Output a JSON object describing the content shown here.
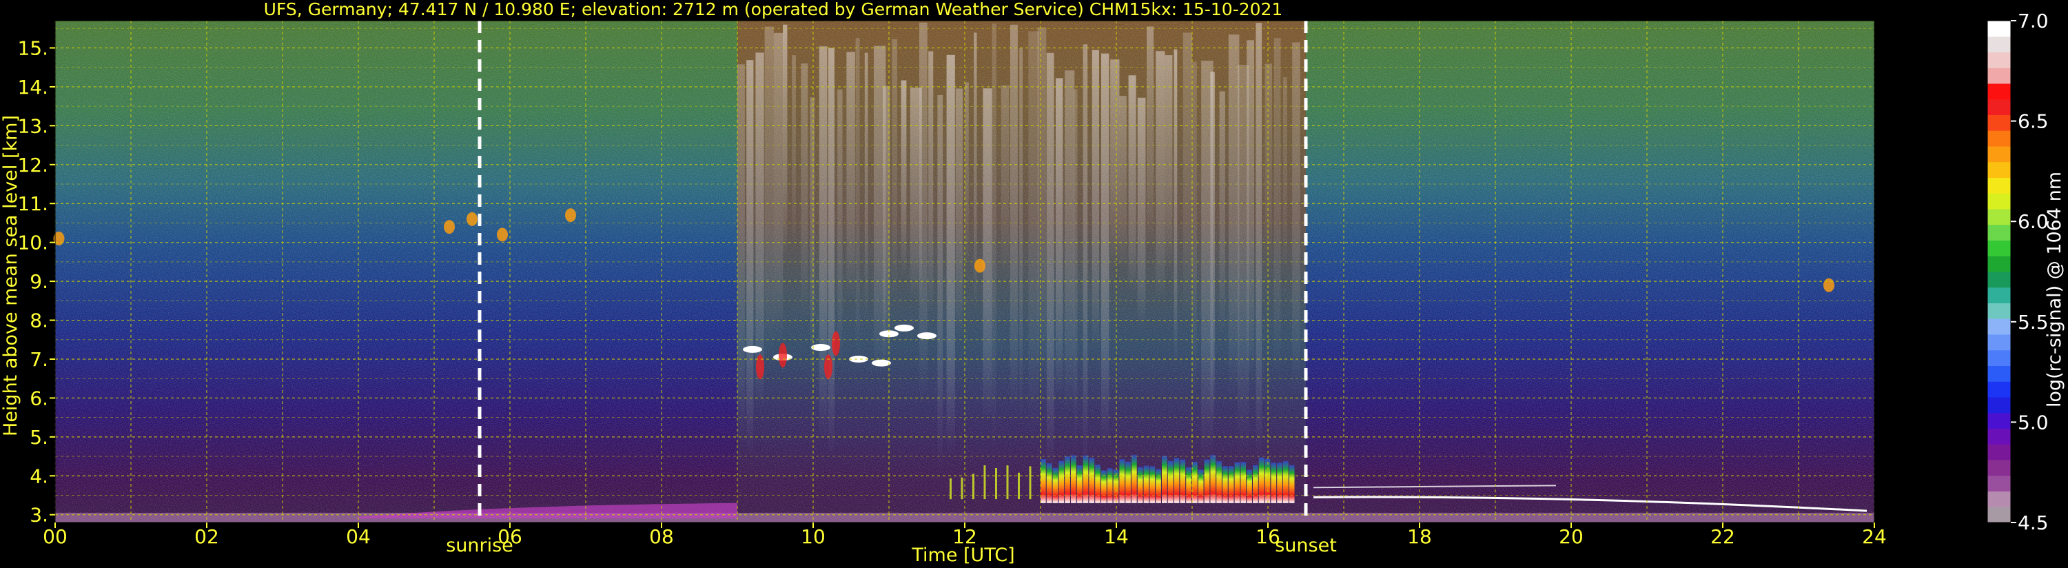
{
  "chart_data": {
    "type": "heatmap",
    "title": "UFS, Germany; 47.417 N / 10.980 E; elevation: 2712 m  (operated by German Weather Service)     CHM15kx: 15-10-2021",
    "xlabel": "Time [UTC]",
    "ylabel": "Height above mean sea level [km]",
    "xlim": [
      0,
      24
    ],
    "ylim": [
      2.8,
      15.7
    ],
    "x_ticks": [
      "00",
      "02",
      "04",
      "06",
      "08",
      "10",
      "12",
      "14",
      "16",
      "18",
      "20",
      "22",
      "24"
    ],
    "y_ticks": [
      "3.",
      "4.",
      "5.",
      "6.",
      "7.",
      "8.",
      "9.",
      "10.",
      "11.",
      "12.",
      "13.",
      "14.",
      "15."
    ],
    "grid": "on",
    "events": [
      {
        "label": "sunrise",
        "time": 5.6
      },
      {
        "label": "sunset",
        "time": 16.5
      }
    ],
    "colorbar": {
      "label": "log(rc-signal) @ 1064 nm",
      "min": 4.5,
      "max": 7.0,
      "ticks": [
        "4.5",
        "5.0",
        "5.5",
        "6.0",
        "6.5",
        "7.0"
      ],
      "colors": [
        "#a89aa4",
        "#b58cb0",
        "#9a4f9e",
        "#8a2f92",
        "#7a189a",
        "#6a10b8",
        "#4a12d0",
        "#2020e0",
        "#1c34f4",
        "#2c5cf8",
        "#4c7cfa",
        "#6a96fa",
        "#8cb2f8",
        "#6ec8c0",
        "#2eb09a",
        "#1a9a5a",
        "#1ea832",
        "#34c834",
        "#6ad84a",
        "#a8e83a",
        "#d8f020",
        "#f4e818",
        "#fcc010",
        "#fc9c10",
        "#fc7810",
        "#f84818",
        "#f02020",
        "#fc1010",
        "#f0a8a8",
        "#f0c8c8",
        "#e8e0e0",
        "#ffffff"
      ]
    }
  },
  "colors": {
    "text": "#ffff33",
    "grid": "#cccc00",
    "tick_text_colorbar": "#ffffff"
  }
}
